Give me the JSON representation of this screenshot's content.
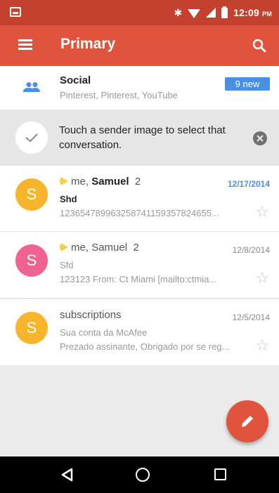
{
  "status_bar": {
    "bluetooth_icon": "bluetooth-icon",
    "time": "12:09",
    "ampm": "PM"
  },
  "toolbar": {
    "title": "Primary",
    "menu_icon": "hamburger-menu-icon",
    "search_icon": "search-icon",
    "color": "#e0533c"
  },
  "social": {
    "title": "Social",
    "subtitle": "Pinterest, Pinterest, YouTube",
    "badge": "9 new",
    "badge_color": "#4a90e2"
  },
  "tip": {
    "text": "Touch a sender image to select that conversation."
  },
  "conversations": [
    {
      "avatar_letter": "S",
      "avatar_color": "#f7b52c",
      "sender_prefix": "me, ",
      "sender_name": "Samuel",
      "count": "2",
      "date": "12/17/2014",
      "subject": "Shd",
      "snippet": "123654789963258741159357824655...",
      "unread": true
    },
    {
      "avatar_letter": "S",
      "avatar_color": "#f06292",
      "sender_prefix": "me, ",
      "sender_name": "Samuel",
      "count": "2",
      "date": "12/8/2014",
      "subject": "Sfd",
      "snippet": "123123 From: Ct Miami [mailto:ctmia...",
      "unread": false
    },
    {
      "avatar_letter": "S",
      "avatar_color": "#f7b52c",
      "sender_name": "subscriptions",
      "date": "12/5/2014",
      "subject": "Sua conta da McAfee",
      "snippet": "Prezado assinante, Obrigado por se reg...",
      "unread": false
    }
  ]
}
